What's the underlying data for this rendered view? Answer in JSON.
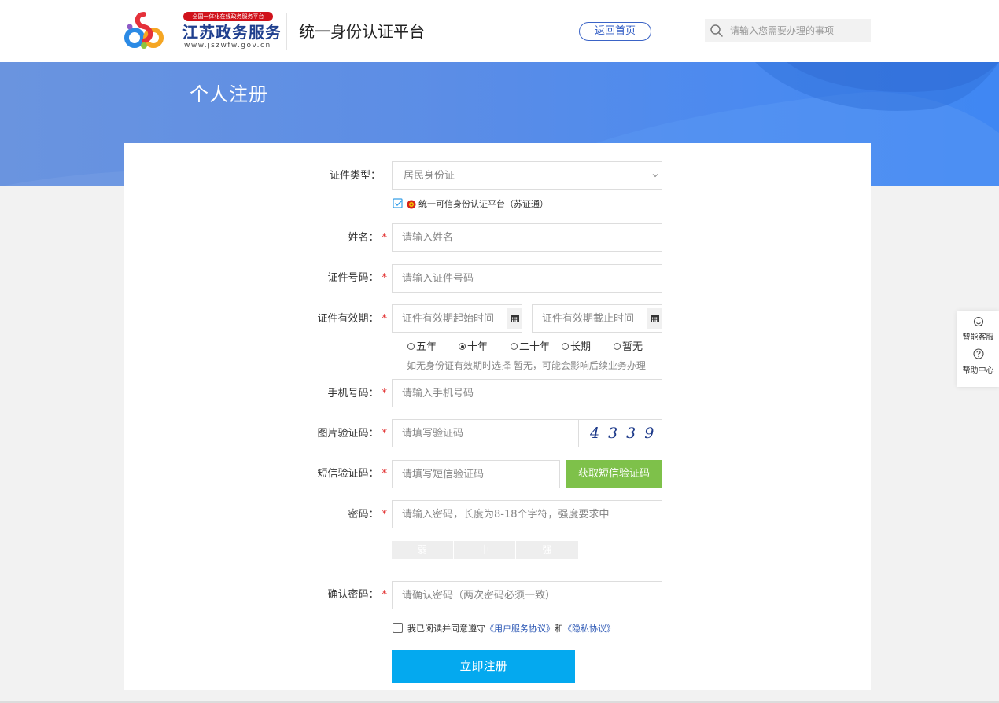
{
  "header": {
    "brand_badge": "全国一体化在线政务服务平台",
    "brand_name": "江苏政务服务",
    "brand_url": "www.jszwfw.gov.cn",
    "platform_title": "统一身份认证平台",
    "back_home": "返回首页",
    "search_placeholder": "请输入您需要办理的事项"
  },
  "banner": {
    "heading": "个人注册"
  },
  "form": {
    "id_type": {
      "label": "证件类型：",
      "value": "居民身份证"
    },
    "trust_platform": "统一可信身份认证平台（苏证通）",
    "name": {
      "label": "姓名：",
      "required": "*",
      "placeholder": "请输入姓名"
    },
    "id_number": {
      "label": "证件号码：",
      "required": "*",
      "placeholder": "请输入证件号码"
    },
    "validity": {
      "label": "证件有效期：",
      "required": "*",
      "start_placeholder": "证件有效期起始时间",
      "end_placeholder": "证件有效期截止时间",
      "options": [
        "五年",
        "十年",
        "二十年",
        "长期",
        "暂无"
      ],
      "selected": "十年",
      "hint": "如无身份证有效期时选择 暂无，可能会影响后续业务办理"
    },
    "phone": {
      "label": "手机号码：",
      "required": "*",
      "placeholder": "请输入手机号码"
    },
    "captcha": {
      "label": "图片验证码：",
      "required": "*",
      "placeholder": "请填写验证码",
      "image_text": "4339"
    },
    "sms": {
      "label": "短信验证码：",
      "required": "*",
      "placeholder": "请填写短信验证码",
      "button": "获取短信验证码"
    },
    "password": {
      "label": "密码：",
      "required": "*",
      "placeholder": "请输入密码，长度为8-18个字符，强度要求中",
      "strength": [
        "弱",
        "中",
        "强"
      ]
    },
    "confirm_password": {
      "label": "确认密码：",
      "required": "*",
      "placeholder": "请确认密码（两次密码必须一致）"
    },
    "agreement": {
      "prefix": "我已阅读并同意遵守",
      "user_agreement": "《用户服务协议》",
      "and": "和",
      "privacy": "《隐私协议》"
    },
    "submit": "立即注册"
  },
  "side_panel": {
    "service": "智能客服",
    "help": "帮助中心"
  },
  "colors": {
    "brand_blue": "#1f3f8e",
    "banner_blue": "#4b8af0",
    "submit_blue": "#04a9ef",
    "sms_green": "#7ec14a",
    "required_red": "#e02020",
    "link_blue": "#2a56b4"
  },
  "icons": [
    "logo-icon",
    "search-icon",
    "chevron-down-icon",
    "checkbox-checked-icon",
    "emblem-icon",
    "calendar-icon",
    "headset-icon",
    "question-icon"
  ]
}
